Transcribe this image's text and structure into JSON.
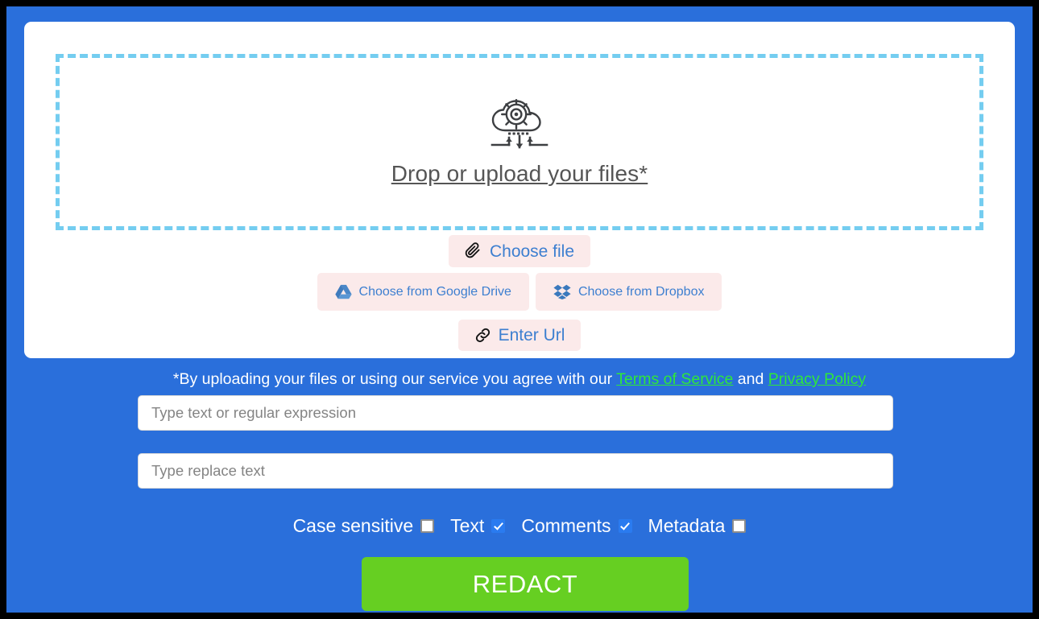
{
  "theme": {
    "page_background": "#2a6fdb",
    "card_background": "#ffffff",
    "dropzone_border": "#74cdf0",
    "source_button_bg": "#fbeaea",
    "source_button_text": "#3d7fd0",
    "link_color": "#2ee83a",
    "redact_button_bg": "#66cf22",
    "checkbox_checked": "#2a7bf0",
    "outer_frame": "#000000"
  },
  "dropzone": {
    "icon": "cloud-gear-upload-icon",
    "label": "Drop or upload your files*"
  },
  "sources": {
    "choose_file": {
      "label": "Choose file",
      "icon": "paperclip-icon"
    },
    "google_drive": {
      "label": "Choose from Google Drive",
      "icon": "google-drive-icon"
    },
    "dropbox": {
      "label": "Choose from Dropbox",
      "icon": "dropbox-icon"
    },
    "enter_url": {
      "label": "Enter Url",
      "icon": "link-icon"
    }
  },
  "terms": {
    "prefix": "*By uploading your files or using our service you agree with our ",
    "terms_link": "Terms of Service",
    "conjunction": " and ",
    "privacy_link": "Privacy Policy"
  },
  "inputs": {
    "search": {
      "placeholder": "Type text or regular expression",
      "value": ""
    },
    "replace": {
      "placeholder": "Type replace text",
      "value": ""
    }
  },
  "options": [
    {
      "label": "Case sensitive",
      "checked": false
    },
    {
      "label": "Text",
      "checked": true
    },
    {
      "label": "Comments",
      "checked": true
    },
    {
      "label": "Metadata",
      "checked": false
    }
  ],
  "actions": {
    "redact_label": "REDACT"
  }
}
